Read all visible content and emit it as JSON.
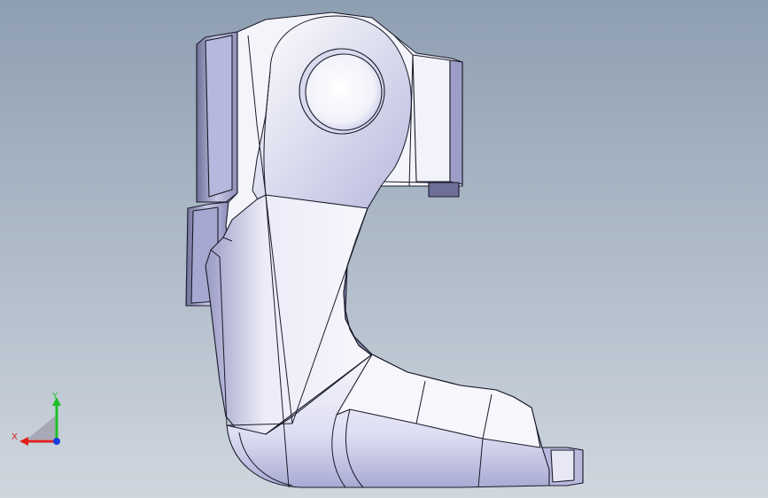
{
  "viewport": {
    "background_top": "#8e9fb2",
    "background_bottom": "#cfd6de"
  },
  "part": {
    "face_color": "#f4f4fb",
    "shade_color": "#cbcbea",
    "dark_shade_color": "#7f80a8",
    "edge_color": "#1a1a2a"
  },
  "triad": {
    "x_label": "X",
    "y_label": "Y",
    "x_color": "#e0201f",
    "y_color": "#1fbf2b",
    "z_color": "#1a3ee0"
  }
}
